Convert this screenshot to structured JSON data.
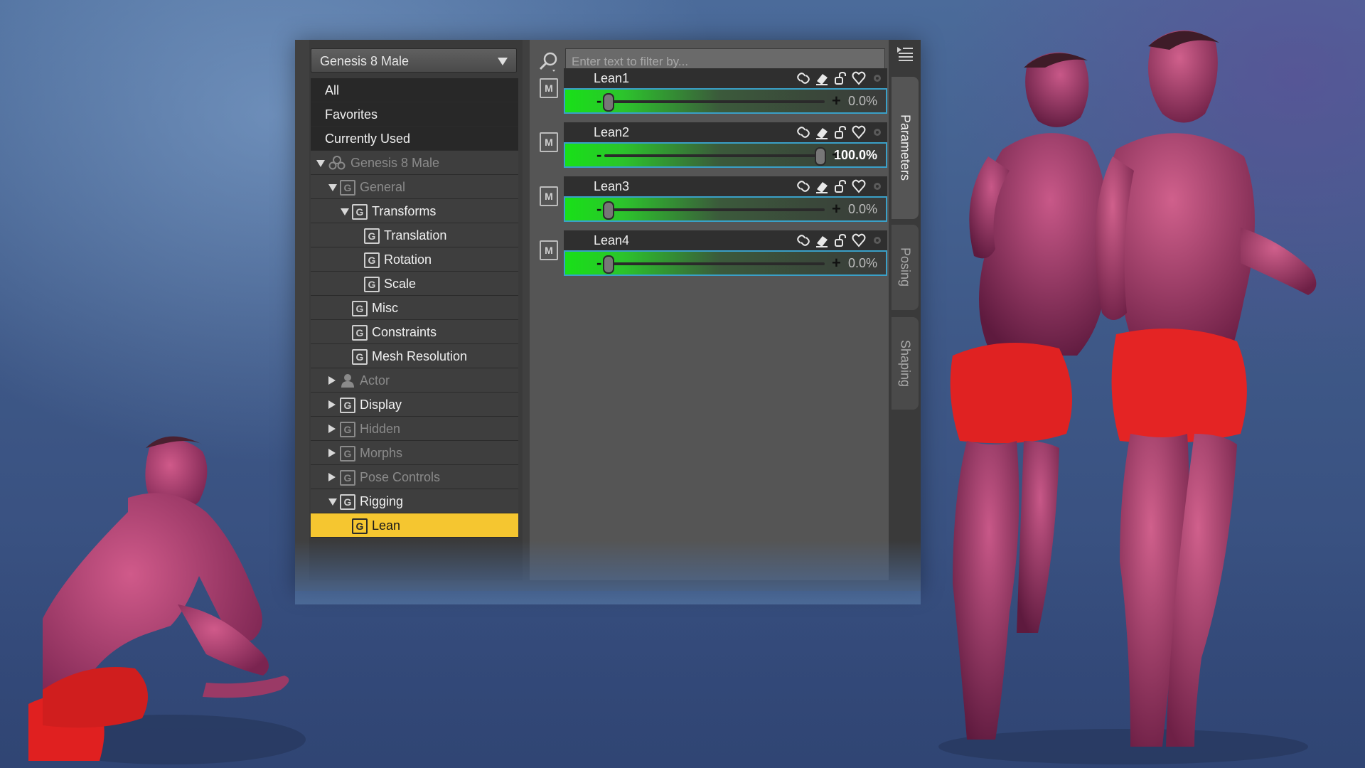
{
  "figure_selector": {
    "value": "Genesis 8 Male"
  },
  "tree": {
    "top_items": [
      {
        "label": "All"
      },
      {
        "label": "Favorites"
      },
      {
        "label": "Currently Used"
      }
    ],
    "nodes": [
      {
        "label": "Genesis 8 Male",
        "indent": 0,
        "twisty": "down",
        "icon": "figure",
        "dim": true
      },
      {
        "label": "General",
        "indent": 1,
        "twisty": "down",
        "icon": "group",
        "dim": true
      },
      {
        "label": "Transforms",
        "indent": 2,
        "twisty": "down",
        "icon": "group",
        "dim": false
      },
      {
        "label": "Translation",
        "indent": 3,
        "twisty": "none",
        "icon": "group",
        "dim": false
      },
      {
        "label": "Rotation",
        "indent": 3,
        "twisty": "none",
        "icon": "group",
        "dim": false
      },
      {
        "label": "Scale",
        "indent": 3,
        "twisty": "none",
        "icon": "group",
        "dim": false
      },
      {
        "label": "Misc",
        "indent": 2,
        "twisty": "none",
        "icon": "group",
        "dim": false
      },
      {
        "label": "Constraints",
        "indent": 2,
        "twisty": "none",
        "icon": "group",
        "dim": false
      },
      {
        "label": "Mesh Resolution",
        "indent": 2,
        "twisty": "none",
        "icon": "group",
        "dim": false
      },
      {
        "label": "Actor",
        "indent": 1,
        "twisty": "right",
        "icon": "actor",
        "dim": true
      },
      {
        "label": "Display",
        "indent": 1,
        "twisty": "right",
        "icon": "group",
        "dim": false
      },
      {
        "label": "Hidden",
        "indent": 1,
        "twisty": "right",
        "icon": "group",
        "dim": true
      },
      {
        "label": "Morphs",
        "indent": 1,
        "twisty": "right",
        "icon": "group",
        "dim": true
      },
      {
        "label": "Pose Controls",
        "indent": 1,
        "twisty": "right",
        "icon": "group",
        "dim": true
      },
      {
        "label": "Rigging",
        "indent": 1,
        "twisty": "down",
        "icon": "group",
        "dim": false
      },
      {
        "label": "Lean",
        "indent": 2,
        "twisty": "none",
        "icon": "group",
        "dim": false,
        "selected": true
      }
    ],
    "group_icon_letter": "G"
  },
  "filter": {
    "placeholder": "Enter text to filter by..."
  },
  "parameters": [
    {
      "name": "Lean1",
      "value_text": "0.0%",
      "fraction": 0.0,
      "highlight": false
    },
    {
      "name": "Lean2",
      "value_text": "100.0%",
      "fraction": 1.0,
      "highlight": true
    },
    {
      "name": "Lean3",
      "value_text": "0.0%",
      "fraction": 0.0,
      "highlight": false
    },
    {
      "name": "Lean4",
      "value_text": "0.0%",
      "fraction": 0.0,
      "highlight": false
    }
  ],
  "param_badge_letter": "M",
  "slider_minus": "-",
  "slider_plus": "+",
  "tabs": [
    {
      "label": "Parameters",
      "active": true
    },
    {
      "label": "Posing",
      "active": false
    },
    {
      "label": "Shaping",
      "active": false
    }
  ],
  "colors": {
    "selection": "#f5c630",
    "slider_green": "#18e018",
    "slider_border": "#3aa0c8"
  }
}
